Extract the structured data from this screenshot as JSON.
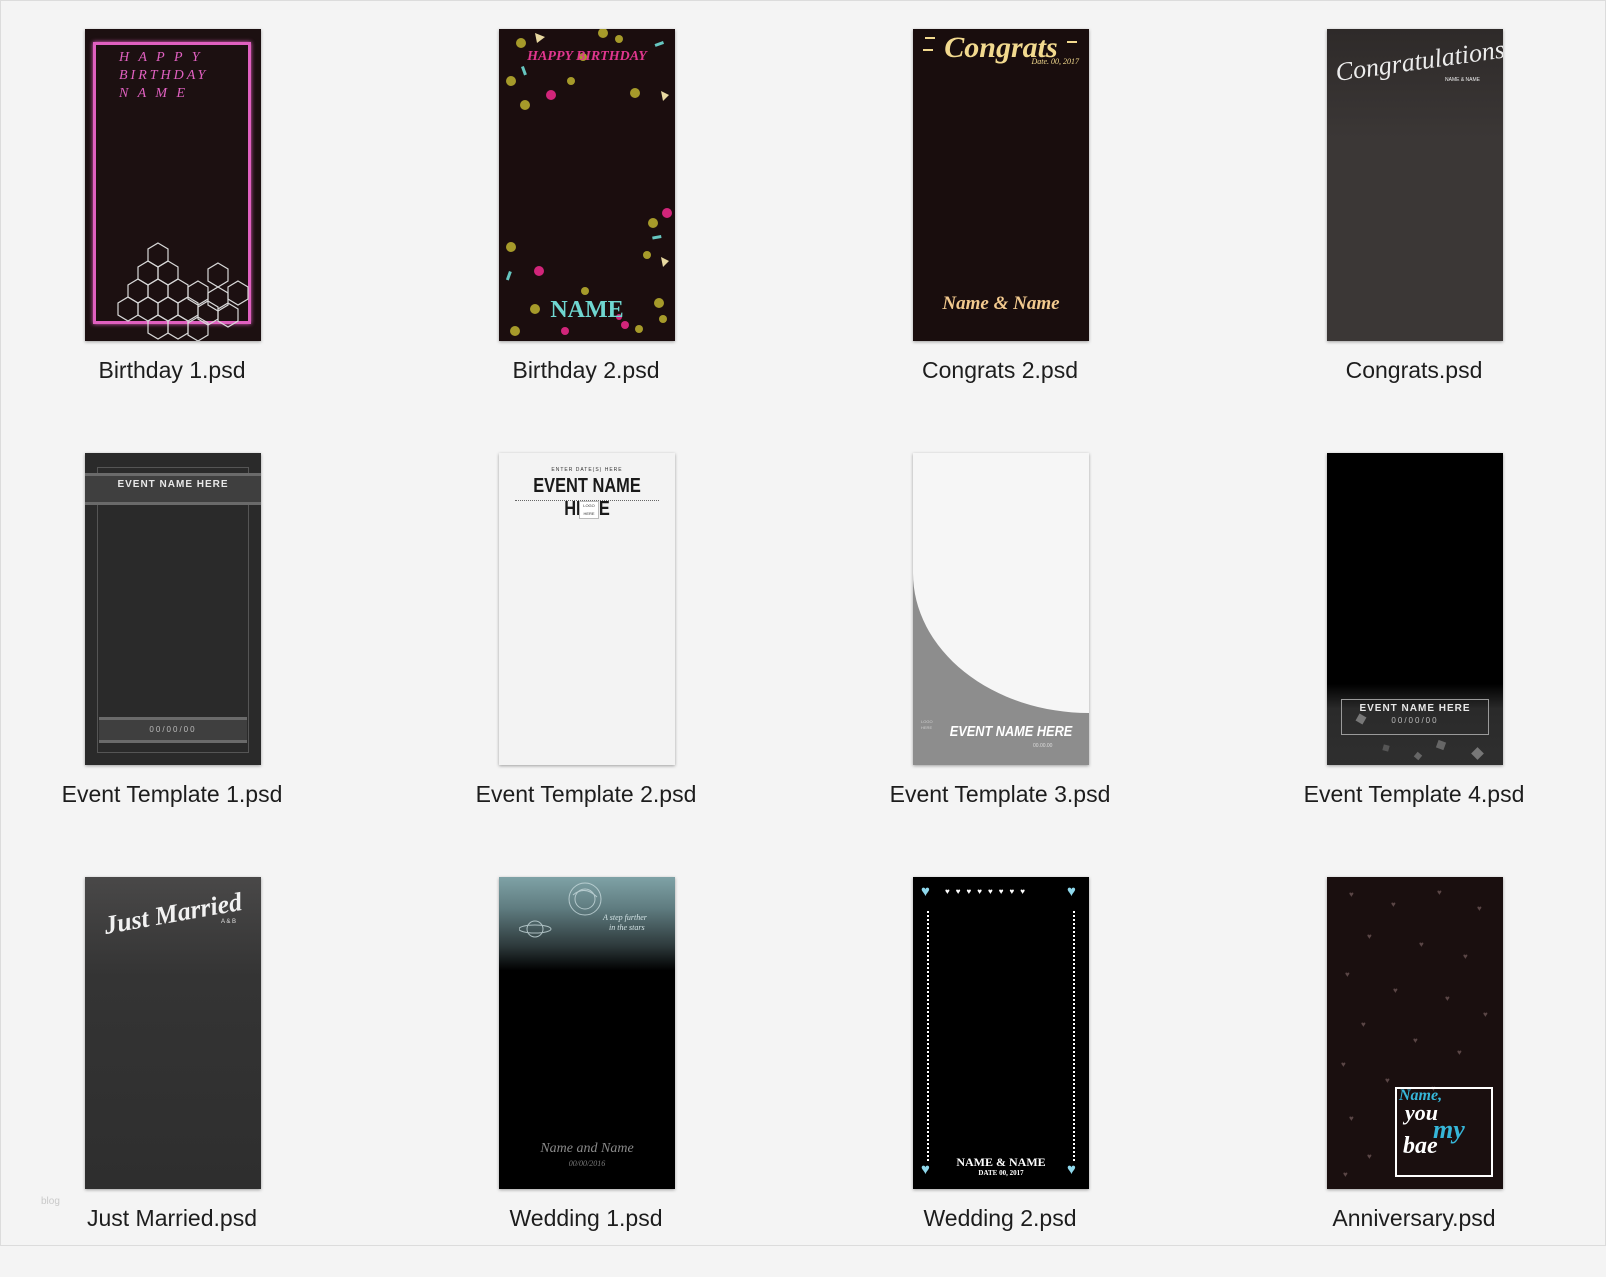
{
  "files": [
    {
      "name": "Birthday 1.psd",
      "preview": {
        "lines": [
          "H A P P Y",
          "BIRTHDAY",
          "N A M E"
        ]
      }
    },
    {
      "name": "Birthday 2.psd",
      "preview": {
        "headline": "HAPPY BIRTHDAY",
        "footer": "NAME"
      }
    },
    {
      "name": "Congrats 2.psd",
      "preview": {
        "headline": "Congrats",
        "date": "Date. 00, 2017",
        "footer": "Name & Name"
      }
    },
    {
      "name": "Congrats.psd",
      "preview": {
        "headline": "Congratulations",
        "sub": "NAME & NAME"
      }
    },
    {
      "name": "Event Template 1.psd",
      "preview": {
        "headline": "EVENT NAME HERE",
        "date": "00/00/00"
      }
    },
    {
      "name": "Event Template 2.psd",
      "preview": {
        "top_line": "ENTER DATE(S) HERE",
        "headline": "EVENT NAME HERE",
        "logo": "LOGO HERE"
      }
    },
    {
      "name": "Event Template 3.psd",
      "preview": {
        "logo": "LOGO HERE",
        "headline": "EVENT NAME HERE",
        "date": "00.00.00"
      }
    },
    {
      "name": "Event Template 4.psd",
      "preview": {
        "headline": "EVENT NAME HERE",
        "date": "00/00/00"
      }
    },
    {
      "name": "Just Married.psd",
      "preview": {
        "headline": "Just Married",
        "sub": "A & B"
      }
    },
    {
      "name": "Wedding 1.psd",
      "preview": {
        "quote_1": "A step further",
        "quote_2": "in the stars",
        "names": "Name and Name",
        "date": "00/00/2016"
      }
    },
    {
      "name": "Wedding 2.psd",
      "preview": {
        "names": "NAME & NAME",
        "date": "DATE 00, 2017"
      }
    },
    {
      "name": "Anniversary.psd",
      "preview": {
        "line_1": "Name,",
        "line_2": "you",
        "line_3": "my",
        "line_4": "bae"
      }
    }
  ],
  "watermark": "blog",
  "colors": {
    "window_bg": "#f4f4f4",
    "label_text": "#1d1d1d",
    "pink": "#e060c0",
    "cyan": "#6fd6d0",
    "gold": "#f2d98e",
    "light_blue": "#8fd8ec"
  }
}
